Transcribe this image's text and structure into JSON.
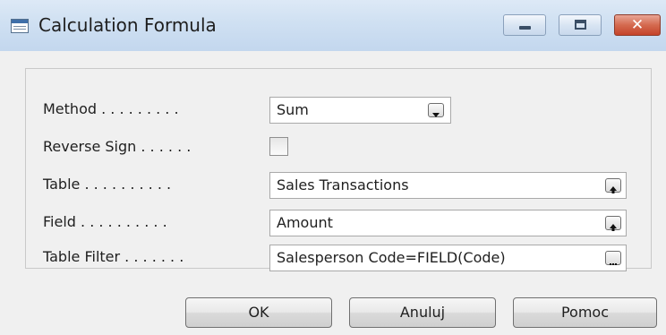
{
  "window": {
    "title": "Calculation Formula",
    "icon": "form-window-icon",
    "controls": {
      "minimize": "minimize-icon",
      "maximize": "maximize-icon",
      "close": "close-icon"
    }
  },
  "form": {
    "method": {
      "label": "Method . . . . . . . . .",
      "value": "Sum",
      "button": "dropdown-arrow-icon"
    },
    "reverse_sign": {
      "label": "Reverse Sign . . . . . .",
      "checked": false
    },
    "table": {
      "label": "Table . . . . . . . . . .",
      "value": "Sales Transactions",
      "button": "lookup-arrow-icon"
    },
    "field": {
      "label": "Field . . . . . . . . . .",
      "value": "Amount",
      "button": "lookup-arrow-icon"
    },
    "table_filter": {
      "label": "Table Filter . . . . . . .",
      "value": "Salesperson Code=FIELD(Code)",
      "button": "assist-edit-icon"
    }
  },
  "buttons": {
    "ok": "OK",
    "cancel": "Anuluj",
    "help": "Pomoc"
  }
}
